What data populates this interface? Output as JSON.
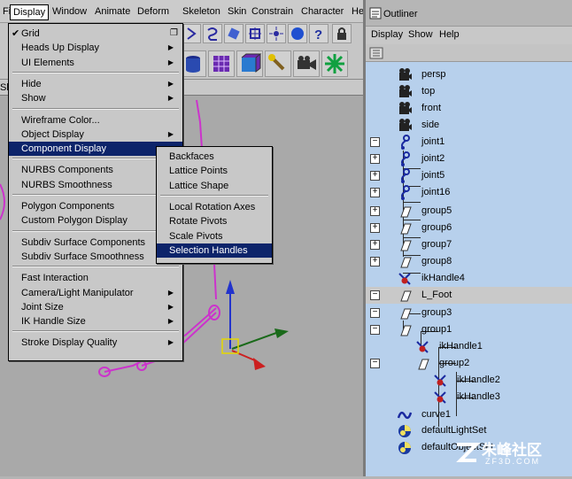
{
  "menubar": {
    "items": [
      "File",
      "Display",
      "Window",
      "Animate",
      "Deform",
      "Skeleton",
      "Skin",
      "Constrain",
      "Character",
      "He"
    ],
    "active": "Display"
  },
  "panel_bar_label": "Sho",
  "display_menu": {
    "items": [
      {
        "label": "Grid",
        "checked": true,
        "option_box": true
      },
      {
        "label": "Heads Up Display",
        "submenu": true
      },
      {
        "label": "UI Elements",
        "submenu": true
      },
      {
        "separator": true
      },
      {
        "label": "Hide",
        "submenu": true
      },
      {
        "label": "Show",
        "submenu": true
      },
      {
        "separator": true
      },
      {
        "label": "Wireframe Color..."
      },
      {
        "label": "Object Display",
        "submenu": true
      },
      {
        "label": "Component Display",
        "submenu": true,
        "highlighted": true
      },
      {
        "separator": true
      },
      {
        "label": "NURBS Components",
        "submenu": true
      },
      {
        "label": "NURBS Smoothness",
        "submenu": true
      },
      {
        "separator": true
      },
      {
        "label": "Polygon Components",
        "submenu": true
      },
      {
        "label": "Custom Polygon Display"
      },
      {
        "separator": true
      },
      {
        "label": "Subdiv Surface Components",
        "submenu": true
      },
      {
        "label": "Subdiv Surface Smoothness",
        "submenu": true
      },
      {
        "separator": true
      },
      {
        "label": "Fast Interaction"
      },
      {
        "label": "Camera/Light Manipulator",
        "submenu": true
      },
      {
        "label": "Joint Size",
        "submenu": true
      },
      {
        "label": "IK Handle Size",
        "submenu": true
      },
      {
        "separator": true
      },
      {
        "label": "Stroke Display Quality",
        "submenu": true
      }
    ]
  },
  "component_submenu": {
    "items": [
      {
        "label": "Backfaces"
      },
      {
        "label": "Lattice Points"
      },
      {
        "label": "Lattice Shape"
      },
      {
        "separator": true
      },
      {
        "label": "Local Rotation Axes"
      },
      {
        "label": "Rotate Pivots"
      },
      {
        "label": "Scale Pivots"
      },
      {
        "label": "Selection Handles",
        "highlighted": true
      }
    ]
  },
  "outliner": {
    "title": "Outliner",
    "menu": [
      "Display",
      "Show",
      "Help"
    ],
    "rows": [
      {
        "label": "persp",
        "icon": "camera-icon",
        "indent": 0,
        "expander": ""
      },
      {
        "label": "top",
        "icon": "camera-icon",
        "indent": 0,
        "expander": ""
      },
      {
        "label": "front",
        "icon": "camera-icon",
        "indent": 0,
        "expander": ""
      },
      {
        "label": "side",
        "icon": "camera-icon",
        "indent": 0,
        "expander": ""
      },
      {
        "label": "joint1",
        "icon": "joint-icon",
        "indent": 0,
        "expander": "-"
      },
      {
        "label": "joint2",
        "icon": "joint-icon",
        "indent": 1,
        "expander": "+"
      },
      {
        "label": "joint5",
        "icon": "joint-icon",
        "indent": 1,
        "expander": "+"
      },
      {
        "label": "joint16",
        "icon": "joint-icon",
        "indent": 1,
        "expander": "+"
      },
      {
        "label": "group5",
        "icon": "group-icon",
        "indent": 1,
        "expander": "+"
      },
      {
        "label": "group6",
        "icon": "group-icon",
        "indent": 1,
        "expander": "+"
      },
      {
        "label": "group7",
        "icon": "group-icon",
        "indent": 1,
        "expander": "+"
      },
      {
        "label": "group8",
        "icon": "group-icon",
        "indent": 1,
        "expander": "+"
      },
      {
        "label": "ikHandle4",
        "icon": "ik-handle-icon",
        "indent": 1,
        "expander": ""
      },
      {
        "label": "L_Foot",
        "icon": "group-icon",
        "indent": 0,
        "expander": "-",
        "selected": true
      },
      {
        "label": "group3",
        "icon": "group-icon",
        "indent": 1,
        "expander": "-"
      },
      {
        "label": "group1",
        "icon": "group-icon",
        "indent": 2,
        "expander": "-"
      },
      {
        "label": "ikHandle1",
        "icon": "ik-handle-icon",
        "indent": 3,
        "expander": ""
      },
      {
        "label": "group2",
        "icon": "group-icon",
        "indent": 3,
        "expander": "-"
      },
      {
        "label": "ikHandle2",
        "icon": "ik-handle-icon",
        "indent": 4,
        "expander": ""
      },
      {
        "label": "ikHandle3",
        "icon": "ik-handle-icon",
        "indent": 4,
        "expander": ""
      },
      {
        "label": "curve1",
        "icon": "curve-icon",
        "indent": 0,
        "expander": ""
      },
      {
        "label": "defaultLightSet",
        "icon": "set-icon",
        "indent": 0,
        "expander": ""
      },
      {
        "label": "defaultObjectSet",
        "icon": "set-icon",
        "indent": 0,
        "expander": ""
      }
    ]
  },
  "watermark": {
    "cn": "朱峰社区",
    "domain": "ZF3D.COM"
  },
  "colors": {
    "highlight": "#0d246a",
    "outliner_bg": "#b7d0ec",
    "wire": "#cc33cc"
  }
}
